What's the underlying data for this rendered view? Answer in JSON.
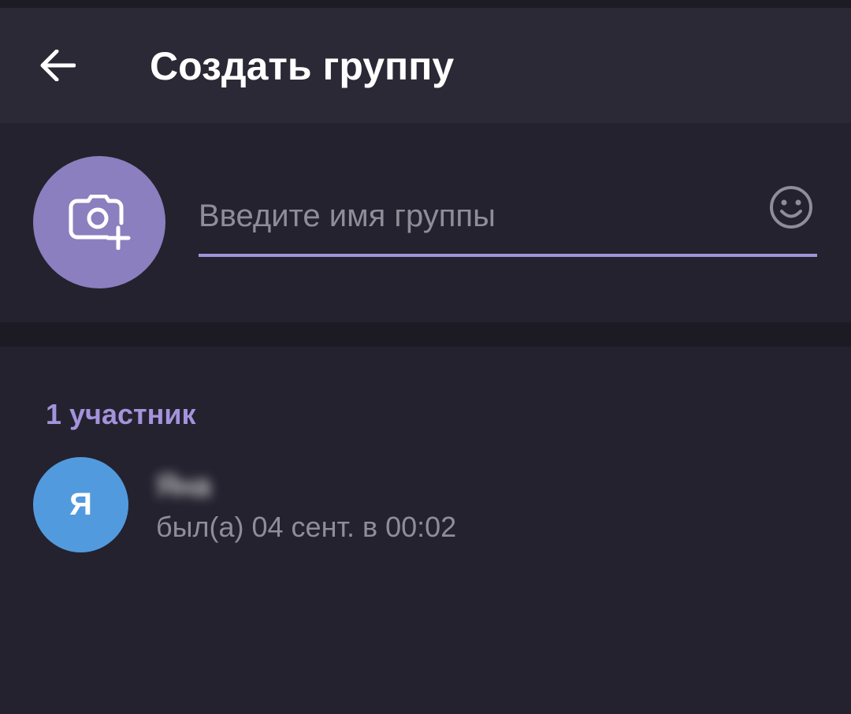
{
  "app_bar": {
    "back_icon": "arrow-left-icon",
    "title": "Создать группу"
  },
  "group_header": {
    "avatar_icon": "camera-add-icon",
    "name_input": {
      "placeholder": "Введите имя группы",
      "value": ""
    },
    "emoji_icon": "smile-icon"
  },
  "members": {
    "header": "1 участник",
    "items": [
      {
        "avatar_letter": "Я",
        "name": "Яна",
        "status": "был(а) 04 сент. в 00:02"
      }
    ]
  },
  "colors": {
    "accent": "#a393dc",
    "avatar_picker_bg": "#8b7fbf",
    "member_avatar_bg": "#529ade",
    "background": "#24222e",
    "app_bar_bg": "#2b2935"
  }
}
